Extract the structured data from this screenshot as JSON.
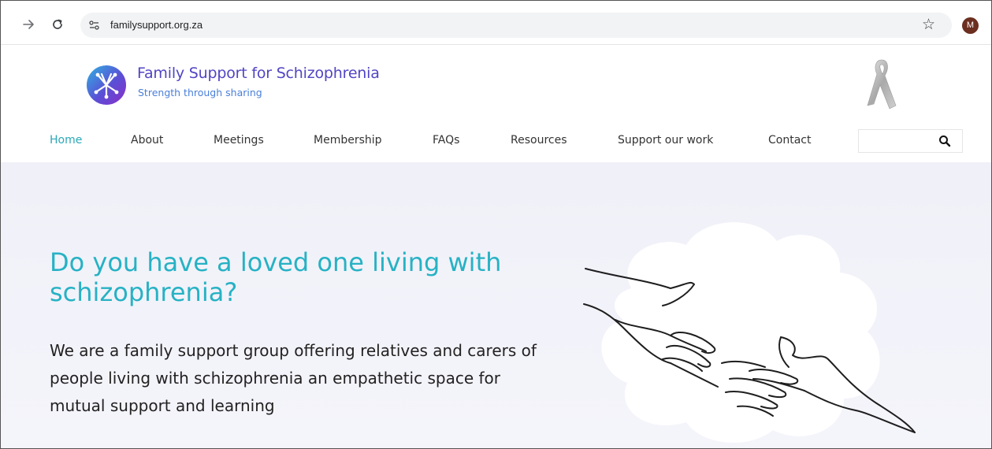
{
  "browser": {
    "back_icon": "back-arrow-icon",
    "reload_icon": "reload-icon",
    "url": "familysupport.org.za",
    "bookmark_icon": "star-icon",
    "profile_initial": "M",
    "profile_color": "#6b2e1f"
  },
  "site": {
    "title": "Family Support for Schizophrenia",
    "tagline": "Strength through sharing",
    "title_color": "#5145c4",
    "tagline_color": "#4a7fd9",
    "accent_color": "#2aa8b8"
  },
  "nav": {
    "items": [
      {
        "label": "Home",
        "active": true
      },
      {
        "label": "About",
        "active": false
      },
      {
        "label": "Meetings",
        "active": false
      },
      {
        "label": "Membership",
        "active": false
      },
      {
        "label": "FAQs",
        "active": false
      },
      {
        "label": "Resources",
        "active": false
      },
      {
        "label": "Support our work",
        "active": false
      },
      {
        "label": "Contact",
        "active": false
      }
    ],
    "search_placeholder": ""
  },
  "hero": {
    "heading": "Do you have a loved one living with schizophrenia?",
    "text": "We are a family support group offering relatives and carers of people living with schizophrenia an empathetic space for mutual support and learning",
    "heading_color": "#26b2c4"
  }
}
